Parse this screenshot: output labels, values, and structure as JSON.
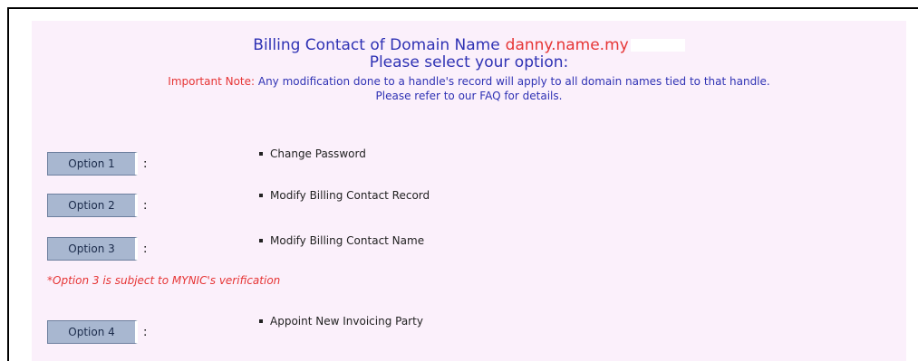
{
  "header": {
    "title_prefix": "Billing Contact of Domain Name",
    "domain": "danny.name.my",
    "select_prompt": "Please select your option:",
    "important_label": "Important Note:",
    "important_text": " Any modification done to a handle's record will apply to all domain names tied to that handle.",
    "faq_text": "Please refer to our FAQ for details."
  },
  "options": [
    {
      "button": "Option 1",
      "colon": ":",
      "item": "Change Password"
    },
    {
      "button": "Option 2",
      "colon": ":",
      "item": "Modify Billing Contact Record"
    },
    {
      "button": "Option 3",
      "colon": ":",
      "item": "Modify Billing Contact Name"
    },
    {
      "button": "Option 4",
      "colon": ":",
      "item": "Appoint New Invoicing Party"
    }
  ],
  "option3_note": "*Option 3 is subject to MYNIC's verification",
  "colors": {
    "panel_bg": "#fbf0fb",
    "title_blue": "#2f32b4",
    "alert_red": "#e63535",
    "button_bg": "#a8b7d0"
  }
}
